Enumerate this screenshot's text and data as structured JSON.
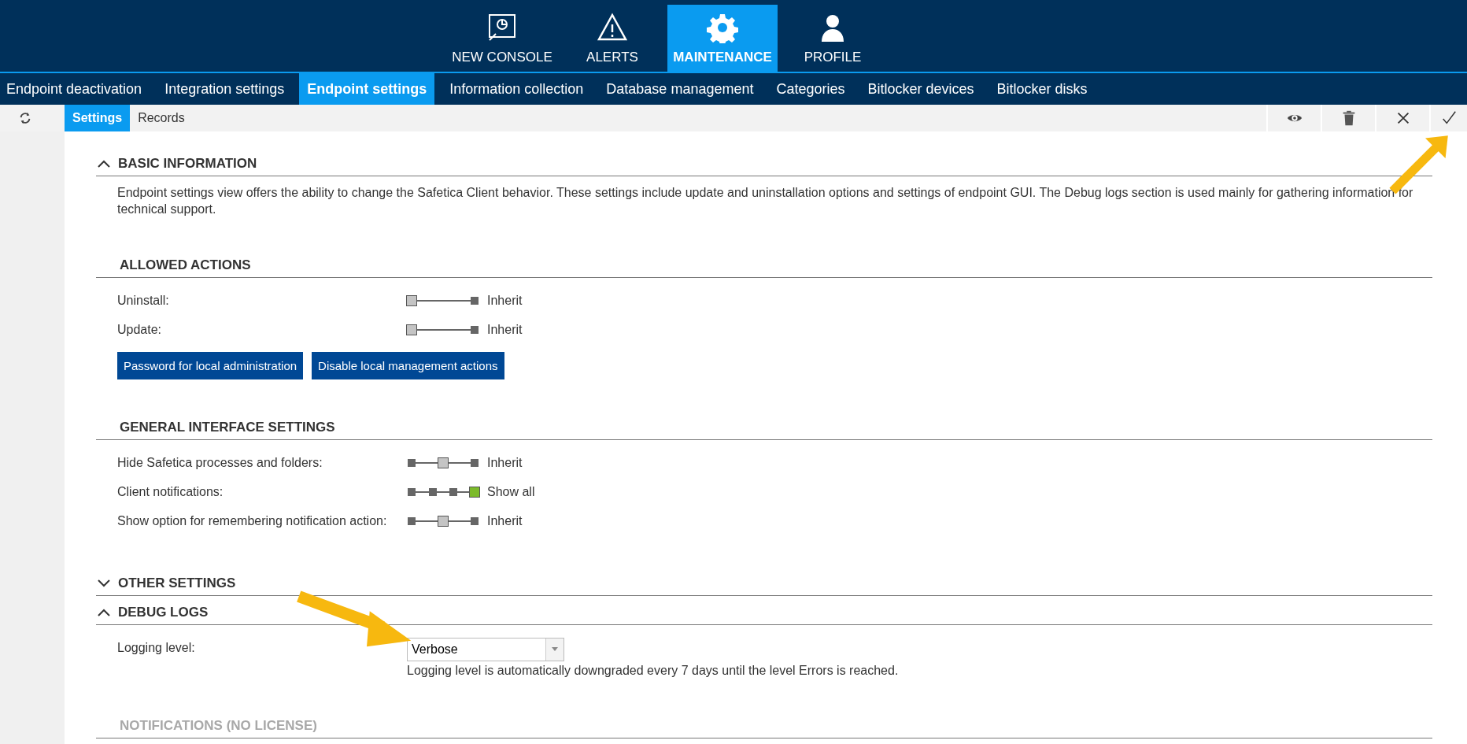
{
  "nav": [
    {
      "label": "NEW CONSOLE",
      "kind": "console",
      "selected": false
    },
    {
      "label": "ALERTS",
      "kind": "alert",
      "selected": false
    },
    {
      "label": "MAINTENANCE",
      "kind": "gear",
      "selected": true
    },
    {
      "label": "PROFILE",
      "kind": "person",
      "selected": false
    }
  ],
  "tabs": [
    {
      "label": "Endpoint deactivation",
      "selected": false
    },
    {
      "label": "Integration settings",
      "selected": false
    },
    {
      "label": "Endpoint settings",
      "selected": true
    },
    {
      "label": "Information collection",
      "selected": false
    },
    {
      "label": "Database management",
      "selected": false
    },
    {
      "label": "Categories",
      "selected": false
    },
    {
      "label": "Bitlocker devices",
      "selected": false
    },
    {
      "label": "Bitlocker disks",
      "selected": false
    }
  ],
  "subtabs": [
    {
      "label": "Settings",
      "selected": true
    },
    {
      "label": "Records",
      "selected": false
    }
  ],
  "toolbar": [
    {
      "kind": "eye"
    },
    {
      "kind": "trash"
    },
    {
      "kind": "close"
    },
    {
      "kind": "check"
    }
  ],
  "sections": [
    {
      "title": "BASIC INFORMATION",
      "expanded": true,
      "disabled": false,
      "description": "Endpoint settings view offers the ability to change the Safetica Client behavior. These settings include update and uninstallation options and settings of endpoint GUI. The Debug logs section is used mainly for gathering information for technical support."
    },
    {
      "title": "ALLOWED ACTIONS",
      "disabled": false,
      "rows": [
        {
          "label": "Uninstall:",
          "kind": "two-step",
          "level": 0,
          "value": "Inherit",
          "color": "#c4c4c4"
        },
        {
          "label": "Update:",
          "kind": "two-step",
          "level": 0,
          "value": "Inherit",
          "color": "#c4c4c4"
        }
      ],
      "buttons": [
        "Password for local administration",
        "Disable local management actions"
      ]
    },
    {
      "title": "GENERAL INTERFACE SETTINGS",
      "disabled": false,
      "rows": [
        {
          "label": "Hide Safetica processes and folders:",
          "kind": "three-step",
          "level": 0.5,
          "value": "Inherit",
          "color": "#c4c4c4"
        },
        {
          "label": "Client notifications:",
          "kind": "four-step",
          "level": 1,
          "value": "Show all",
          "color": "#7cbb2a"
        },
        {
          "label": "Show option for remembering notification action:",
          "kind": "three-step",
          "level": 0.5,
          "value": "Inherit",
          "color": "#c4c4c4"
        }
      ]
    },
    {
      "title": "OTHER SETTINGS",
      "expanded": false,
      "disabled": false
    },
    {
      "title": "DEBUG LOGS",
      "expanded": true,
      "disabled": false,
      "fields": [
        {
          "label": "Logging level:",
          "value": "Verbose",
          "note": "Logging level is automatically downgraded every 7 days until the level Errors is reached."
        }
      ]
    },
    {
      "title": "NOTIFICATIONS (NO LICENSE)",
      "disabled": true
    }
  ]
}
